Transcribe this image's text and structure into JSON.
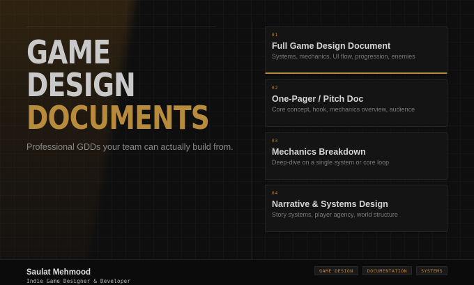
{
  "hero": {
    "line1": "GAME",
    "line2": "DESIGN",
    "line3": "DOCUMENTS",
    "subtitle": "Professional GDDs your team can actually build from."
  },
  "cards": [
    {
      "num": "01",
      "title": "Full Game Design Document",
      "desc": "Systems, mechanics, UI flow, progression, enemies",
      "active": true
    },
    {
      "num": "02",
      "title": "One-Pager / Pitch Doc",
      "desc": "Core concept, hook, mechanics overview, audience",
      "active": false
    },
    {
      "num": "03",
      "title": "Mechanics Breakdown",
      "desc": "Deep-dive on a single system or core loop",
      "active": false
    },
    {
      "num": "04",
      "title": "Narrative & Systems Design",
      "desc": "Story systems, player agency, world structure",
      "active": false
    }
  ],
  "footer": {
    "author": "Saulat Mehmood",
    "role": "Indie Game Designer & Developer",
    "tags": [
      "GAME DESIGN",
      "DOCUMENTATION",
      "SYSTEMS"
    ]
  },
  "colors": {
    "accent": "#b88a3c",
    "tag_text": "#c6873a",
    "background": "#0e0e0f"
  }
}
